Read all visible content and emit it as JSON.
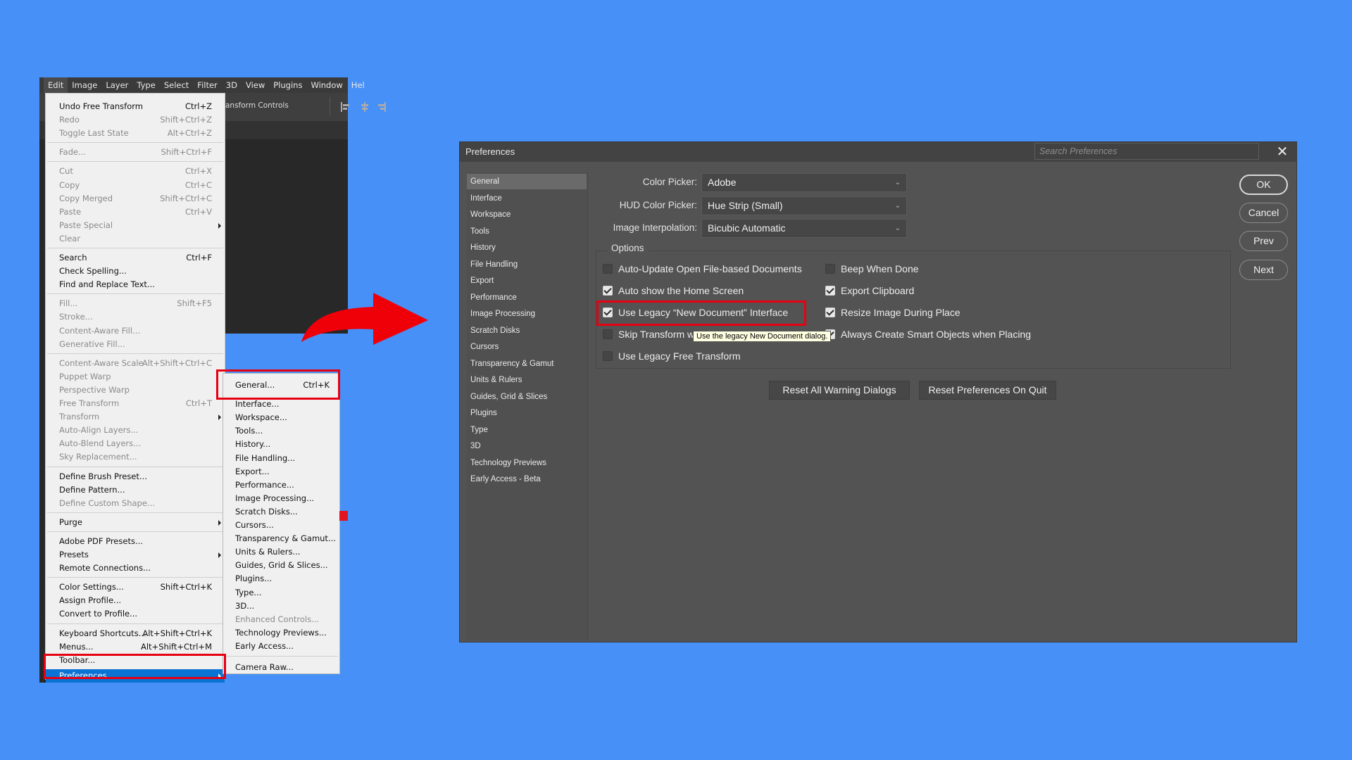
{
  "photoshop": {
    "menubar": [
      "Edit",
      "Image",
      "Layer",
      "Type",
      "Select",
      "Filter",
      "3D",
      "View",
      "Plugins",
      "Window",
      "Hel"
    ],
    "active_menu": "Edit",
    "options_bar_text": "ansform Controls"
  },
  "edit_menu": {
    "groups": [
      [
        {
          "label": "Undo Free Transform",
          "shortcut": "Ctrl+Z",
          "enabled": true
        },
        {
          "label": "Redo",
          "shortcut": "Shift+Ctrl+Z",
          "enabled": false
        },
        {
          "label": "Toggle Last State",
          "shortcut": "Alt+Ctrl+Z",
          "enabled": false
        }
      ],
      [
        {
          "label": "Fade...",
          "shortcut": "Shift+Ctrl+F",
          "enabled": false
        }
      ],
      [
        {
          "label": "Cut",
          "shortcut": "Ctrl+X",
          "enabled": false
        },
        {
          "label": "Copy",
          "shortcut": "Ctrl+C",
          "enabled": false
        },
        {
          "label": "Copy Merged",
          "shortcut": "Shift+Ctrl+C",
          "enabled": false
        },
        {
          "label": "Paste",
          "shortcut": "Ctrl+V",
          "enabled": false
        },
        {
          "label": "Paste Special",
          "shortcut": "",
          "enabled": false,
          "submenu": true
        },
        {
          "label": "Clear",
          "shortcut": "",
          "enabled": false
        }
      ],
      [
        {
          "label": "Search",
          "shortcut": "Ctrl+F",
          "enabled": true
        },
        {
          "label": "Check Spelling...",
          "shortcut": "",
          "enabled": true
        },
        {
          "label": "Find and Replace Text...",
          "shortcut": "",
          "enabled": true
        }
      ],
      [
        {
          "label": "Fill...",
          "shortcut": "Shift+F5",
          "enabled": false
        },
        {
          "label": "Stroke...",
          "shortcut": "",
          "enabled": false
        },
        {
          "label": "Content-Aware Fill...",
          "shortcut": "",
          "enabled": false
        },
        {
          "label": "Generative Fill...",
          "shortcut": "",
          "enabled": false
        }
      ],
      [
        {
          "label": "Content-Aware Scale",
          "shortcut": "Alt+Shift+Ctrl+C",
          "enabled": false
        },
        {
          "label": "Puppet Warp",
          "shortcut": "",
          "enabled": false
        },
        {
          "label": "Perspective Warp",
          "shortcut": "",
          "enabled": false
        },
        {
          "label": "Free Transform",
          "shortcut": "Ctrl+T",
          "enabled": false
        },
        {
          "label": "Transform",
          "shortcut": "",
          "enabled": false,
          "submenu": true
        },
        {
          "label": "Auto-Align Layers...",
          "shortcut": "",
          "enabled": false
        },
        {
          "label": "Auto-Blend Layers...",
          "shortcut": "",
          "enabled": false
        },
        {
          "label": "Sky Replacement...",
          "shortcut": "",
          "enabled": false
        }
      ],
      [
        {
          "label": "Define Brush Preset...",
          "shortcut": "",
          "enabled": true
        },
        {
          "label": "Define Pattern...",
          "shortcut": "",
          "enabled": true
        },
        {
          "label": "Define Custom Shape...",
          "shortcut": "",
          "enabled": false
        }
      ],
      [
        {
          "label": "Purge",
          "shortcut": "",
          "enabled": true,
          "submenu": true
        }
      ],
      [
        {
          "label": "Adobe PDF Presets...",
          "shortcut": "",
          "enabled": true
        },
        {
          "label": "Presets",
          "shortcut": "",
          "enabled": true,
          "submenu": true
        },
        {
          "label": "Remote Connections...",
          "shortcut": "",
          "enabled": true
        }
      ],
      [
        {
          "label": "Color Settings...",
          "shortcut": "Shift+Ctrl+K",
          "enabled": true
        },
        {
          "label": "Assign Profile...",
          "shortcut": "",
          "enabled": true
        },
        {
          "label": "Convert to Profile...",
          "shortcut": "",
          "enabled": true
        }
      ],
      [
        {
          "label": "Keyboard Shortcuts...",
          "shortcut": "Alt+Shift+Ctrl+K",
          "enabled": true
        },
        {
          "label": "Menus...",
          "shortcut": "Alt+Shift+Ctrl+M",
          "enabled": true
        },
        {
          "label": "Toolbar...",
          "shortcut": "",
          "enabled": true
        },
        {
          "label": "Preferences",
          "shortcut": "",
          "enabled": true,
          "submenu": true,
          "selected": true
        }
      ]
    ]
  },
  "preferences_submenu": {
    "items": [
      {
        "label": "General...",
        "shortcut": "Ctrl+K",
        "enabled": true
      },
      {
        "label": "Interface...",
        "shortcut": "",
        "enabled": true
      },
      {
        "label": "Workspace...",
        "shortcut": "",
        "enabled": true
      },
      {
        "label": "Tools...",
        "shortcut": "",
        "enabled": true
      },
      {
        "label": "History...",
        "shortcut": "",
        "enabled": true
      },
      {
        "label": "File Handling...",
        "shortcut": "",
        "enabled": true
      },
      {
        "label": "Export...",
        "shortcut": "",
        "enabled": true
      },
      {
        "label": "Performance...",
        "shortcut": "",
        "enabled": true
      },
      {
        "label": "Image Processing...",
        "shortcut": "",
        "enabled": true
      },
      {
        "label": "Scratch Disks...",
        "shortcut": "",
        "enabled": true
      },
      {
        "label": "Cursors...",
        "shortcut": "",
        "enabled": true
      },
      {
        "label": "Transparency & Gamut...",
        "shortcut": "",
        "enabled": true
      },
      {
        "label": "Units & Rulers...",
        "shortcut": "",
        "enabled": true
      },
      {
        "label": "Guides, Grid & Slices...",
        "shortcut": "",
        "enabled": true
      },
      {
        "label": "Plugins...",
        "shortcut": "",
        "enabled": true
      },
      {
        "label": "Type...",
        "shortcut": "",
        "enabled": true
      },
      {
        "label": "3D...",
        "shortcut": "",
        "enabled": true
      },
      {
        "label": "Enhanced Controls...",
        "shortcut": "",
        "enabled": false
      },
      {
        "label": "Technology Previews...",
        "shortcut": "",
        "enabled": true
      },
      {
        "label": "Early Access...",
        "shortcut": "",
        "enabled": true
      }
    ],
    "after_separator": [
      {
        "label": "Camera Raw...",
        "shortcut": "",
        "enabled": true
      }
    ]
  },
  "dialog": {
    "title": "Preferences",
    "search_placeholder": "Search Preferences",
    "close_label": "✕",
    "sidebar": [
      "General",
      "Interface",
      "Workspace",
      "Tools",
      "History",
      "File Handling",
      "Export",
      "Performance",
      "Image Processing",
      "Scratch Disks",
      "Cursors",
      "Transparency & Gamut",
      "Units & Rulers",
      "Guides, Grid & Slices",
      "Plugins",
      "Type",
      "3D",
      "Technology Previews",
      "Early Access - Beta"
    ],
    "active_section": "General",
    "fields": {
      "color_picker": {
        "label": "Color Picker:",
        "value": "Adobe"
      },
      "hud_color_picker": {
        "label": "HUD Color Picker:",
        "value": "Hue Strip (Small)"
      },
      "image_interpolation": {
        "label": "Image Interpolation:",
        "value": "Bicubic Automatic"
      }
    },
    "options_legend": "Options",
    "options_left": [
      {
        "label": "Auto-Update Open File-based Documents",
        "checked": false
      },
      {
        "label": "Auto show the Home Screen",
        "checked": true
      },
      {
        "label": "Use Legacy “New Document” Interface",
        "checked": true
      },
      {
        "label": "Skip Transform when Placing",
        "checked": false
      },
      {
        "label": "Use Legacy Free Transform",
        "checked": false
      }
    ],
    "options_right": [
      {
        "label": "Beep When Done",
        "checked": false
      },
      {
        "label": "Export Clipboard",
        "checked": true
      },
      {
        "label": "Resize Image During Place",
        "checked": true
      },
      {
        "label": "Always Create Smart Objects when Placing",
        "checked": true
      }
    ],
    "tooltip": "Use the legacy New Document dialog.",
    "reset_warnings": "Reset All Warning Dialogs",
    "reset_prefs": "Reset Preferences On Quit",
    "buttons": {
      "ok": "OK",
      "cancel": "Cancel",
      "prev": "Prev",
      "next": "Next"
    }
  },
  "colors": {
    "background": "#4690f8",
    "highlight": "#e60012",
    "menu_selection": "#0b73d3",
    "dialog_bg": "#535353"
  }
}
